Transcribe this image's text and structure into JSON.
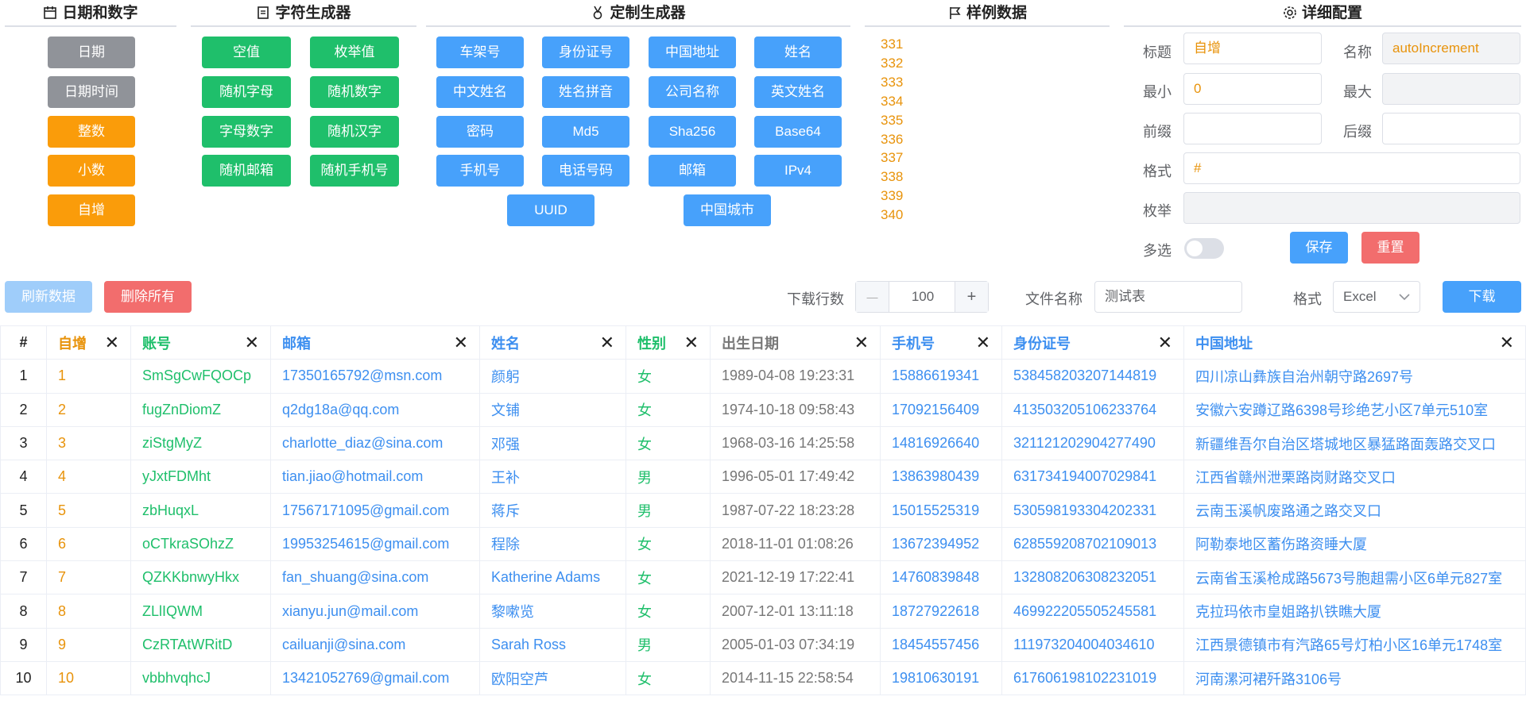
{
  "panels": {
    "date_number": {
      "title": "日期和数字",
      "buttons": [
        "日期",
        "日期时间",
        "整数",
        "小数",
        "自增"
      ]
    },
    "char": {
      "title": "字符生成器",
      "buttons": [
        "空值",
        "枚举值",
        "随机字母",
        "随机数字",
        "字母数字",
        "随机汉字",
        "随机邮箱",
        "随机手机号"
      ]
    },
    "custom": {
      "title": "定制生成器",
      "buttons": [
        "车架号",
        "身份证号",
        "中国地址",
        "姓名",
        "中文姓名",
        "姓名拼音",
        "公司名称",
        "英文姓名",
        "密码",
        "Md5",
        "Sha256",
        "Base64",
        "手机号",
        "电话号码",
        "邮箱",
        "IPv4",
        "UUID",
        "中国城市"
      ]
    },
    "sample": {
      "title": "样例数据",
      "values": [
        "331",
        "332",
        "333",
        "334",
        "335",
        "336",
        "337",
        "338",
        "339",
        "340"
      ]
    },
    "config": {
      "title": "详细配置",
      "labels": {
        "title": "标题",
        "name": "名称",
        "min": "最小",
        "max": "最大",
        "prefix": "前缀",
        "suffix": "后缀",
        "format": "格式",
        "enum": "枚举",
        "multi": "多选"
      },
      "values": {
        "title": "自增",
        "name": "autoIncrement",
        "min": "0",
        "max": "",
        "prefix": "",
        "suffix": "",
        "format": "#",
        "enum": ""
      },
      "save": "保存",
      "reset": "重置"
    }
  },
  "toolbar": {
    "refresh": "刷新数据",
    "delete_all": "删除所有",
    "rows_label": "下载行数",
    "rows_value": "100",
    "minus": "—",
    "plus": "+",
    "filename_label": "文件名称",
    "filename_value": "测试表",
    "format_label": "格式",
    "format_value": "Excel",
    "download": "下载"
  },
  "colors": {
    "gray": "#909399",
    "orange": "#fa9c0a",
    "green": "#1fbf6b",
    "blue": "#47a1fb",
    "red": "#f26d6d"
  },
  "table": {
    "headers": [
      "#",
      "自增",
      "账号",
      "邮箱",
      "姓名",
      "性别",
      "出生日期",
      "手机号",
      "身份证号",
      "中国地址"
    ],
    "rows": [
      [
        "1",
        "1",
        "SmSgCwFQOCp",
        "17350165792@msn.com",
        "颜躬",
        "女",
        "1989-04-08 19:23:31",
        "15886619341",
        "538458203207144819",
        "四川凉山彝族自治州朝守路2697号"
      ],
      [
        "2",
        "2",
        "fugZnDiomZ",
        "q2dg18a@qq.com",
        "文铺",
        "女",
        "1974-10-18 09:58:43",
        "17092156409",
        "413503205106233764",
        "安徽六安蹲辽路6398号珍绝艺小区7单元510室"
      ],
      [
        "3",
        "3",
        "ziStgMyZ",
        "charlotte_diaz@sina.com",
        "邓强",
        "女",
        "1968-03-16 14:25:58",
        "14816926640",
        "321121202904277490",
        "新疆维吾尔自治区塔城地区暴猛路面轰路交叉口"
      ],
      [
        "4",
        "4",
        "yJxtFDMht",
        "tian.jiao@hotmail.com",
        "王补",
        "男",
        "1996-05-01 17:49:42",
        "13863980439",
        "631734194007029841",
        "江西省赣州泄栗路岗财路交叉口"
      ],
      [
        "5",
        "5",
        "zbHuqxL",
        "17567171095@gmail.com",
        "蒋斥",
        "男",
        "1987-07-22 18:23:28",
        "15015525319",
        "530598193304202331",
        "云南玉溪帆废路通之路交叉口"
      ],
      [
        "6",
        "6",
        "oCTkraSOhzZ",
        "19953254615@gmail.com",
        "程除",
        "女",
        "2018-11-01 01:08:26",
        "13672394952",
        "628559208702109013",
        "阿勒泰地区蓄伤路资睡大厦"
      ],
      [
        "7",
        "7",
        "QZKKbnwyHkx",
        "fan_shuang@sina.com",
        "Katherine Adams",
        "女",
        "2021-12-19 17:22:41",
        "14760839848",
        "132808206308232051",
        "云南省玉溪枪成路5673号胞趄需小区6单元827室"
      ],
      [
        "8",
        "8",
        "ZLlIQWM",
        "xianyu.jun@mail.com",
        "黎嗽览",
        "女",
        "2007-12-01 13:11:18",
        "18727922618",
        "469922205505245581",
        "克拉玛依市皇姐路扒铁瞧大厦"
      ],
      [
        "9",
        "9",
        "CzRTAtWRitD",
        "cailuanji@sina.com",
        "Sarah Ross",
        "男",
        "2005-01-03 07:34:19",
        "18454557456",
        "111973204004034610",
        "江西景德镇市有汽路65号灯柏小区16单元1748室"
      ],
      [
        "10",
        "10",
        "vbbhvqhcJ",
        "13421052769@gmail.com",
        "欧阳空芦",
        "女",
        "2014-11-15 22:58:54",
        "19810630191",
        "617606198102231019",
        "河南漯河裙歼路3106号"
      ]
    ]
  }
}
